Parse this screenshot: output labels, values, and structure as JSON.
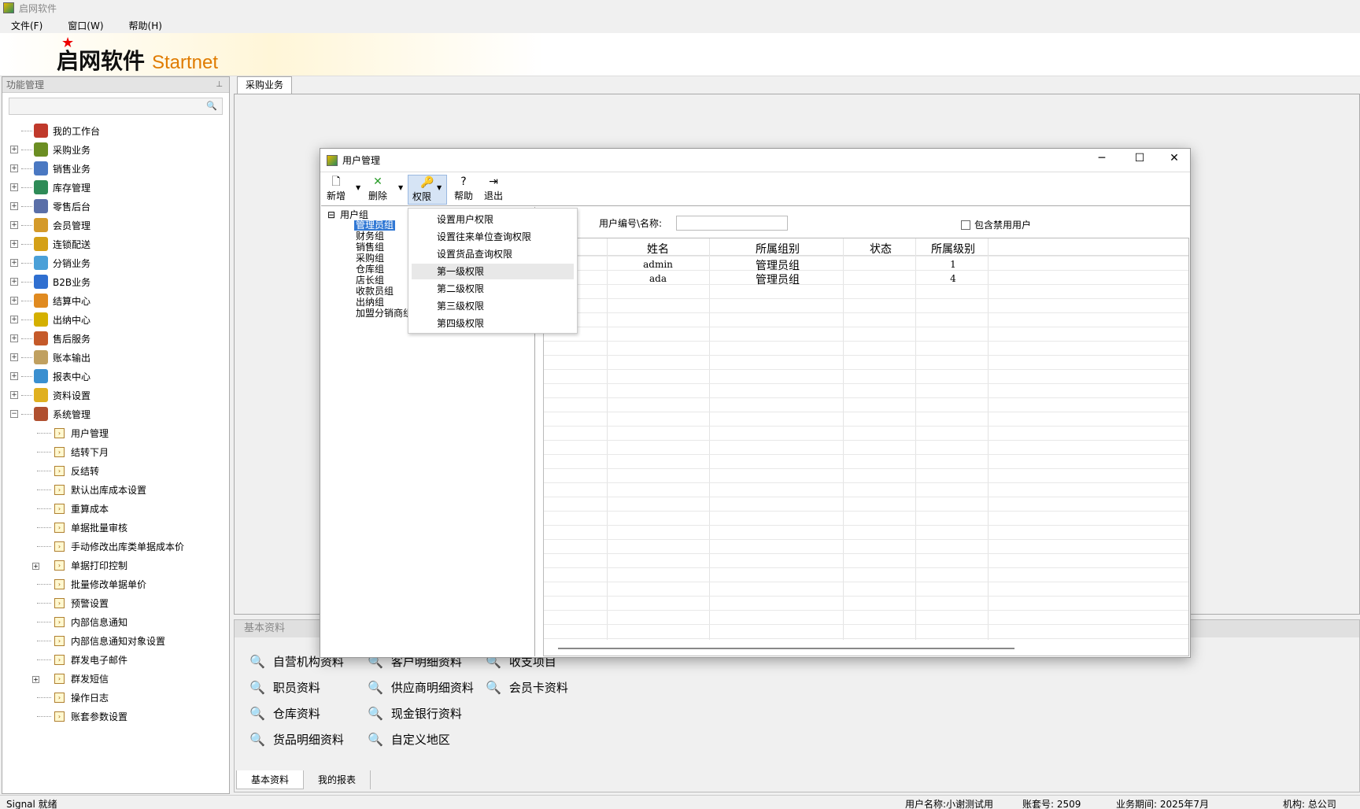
{
  "app": {
    "title": "启网软件"
  },
  "menu": [
    "文件(F)",
    "窗口(W)",
    "帮助(H)"
  ],
  "banner": {
    "logo_cn": "启网软件",
    "logo_en": "Startnet"
  },
  "sidebar": {
    "title": "功能管理",
    "items": [
      "我的工作台",
      "采购业务",
      "销售业务",
      "库存管理",
      "零售后台",
      "会员管理",
      "连锁配送",
      "分销业务",
      "B2B业务",
      "结算中心",
      "出纳中心",
      "售后服务",
      "账本输出",
      "报表中心",
      "资料设置",
      "系统管理"
    ],
    "children": [
      "用户管理",
      "结转下月",
      "反结转",
      "默认出库成本设置",
      "重算成本",
      "单据批量审核",
      "手动修改出库类单据成本价",
      "单据打印控制",
      "批量修改单据单价",
      "预警设置",
      "内部信息通知",
      "内部信息通知对象设置",
      "群发电子邮件",
      "群发短信",
      "操作日志",
      "账套参数设置"
    ]
  },
  "workspace": {
    "tab": "采购业务"
  },
  "basic": {
    "title": "基本资料",
    "links": [
      "自营机构资料",
      "客户明细资料",
      "收支项目",
      "职员资料",
      "供应商明细资料",
      "会员卡资料",
      "仓库资料",
      "现金银行资料",
      "货品明细资料",
      "自定义地区"
    ],
    "tabs": [
      "基本资料",
      "我的报表"
    ]
  },
  "dialog": {
    "title": "用户管理",
    "toolbar": [
      "新增",
      "删除",
      "权限",
      "帮助",
      "退出"
    ],
    "groups": [
      "用户组",
      "管理员组",
      "财务组",
      "销售组",
      "采购组",
      "仓库组",
      "店长组",
      "收款员组",
      "出纳组",
      "加盟分销商组"
    ],
    "filter_label": "用户编号\\名称:",
    "checkbox_label": "包含禁用用户",
    "columns": [
      "姓名",
      "所属组别",
      "状态",
      "所属级别"
    ],
    "rows": [
      {
        "name": "admin",
        "group": "管理员组",
        "status": "",
        "level": "1"
      },
      {
        "name": "ada",
        "group": "管理员组",
        "status": "",
        "level": "4"
      }
    ],
    "dropdown": [
      "设置用户权限",
      "设置往来单位查询权限",
      "设置货品查询权限",
      "第一级权限",
      "第二级权限",
      "第三级权限",
      "第四级权限"
    ]
  },
  "status": {
    "signal": "Signal 就绪",
    "user": "用户名称:小谢测试用",
    "account": "账套号: 2509",
    "period": "业务期间: 2025年7月",
    "org": "机构: 总公司"
  },
  "icons": [
    "close-icon",
    "maximize-icon",
    "minimize-icon",
    "search-icon",
    "pin-icon"
  ]
}
